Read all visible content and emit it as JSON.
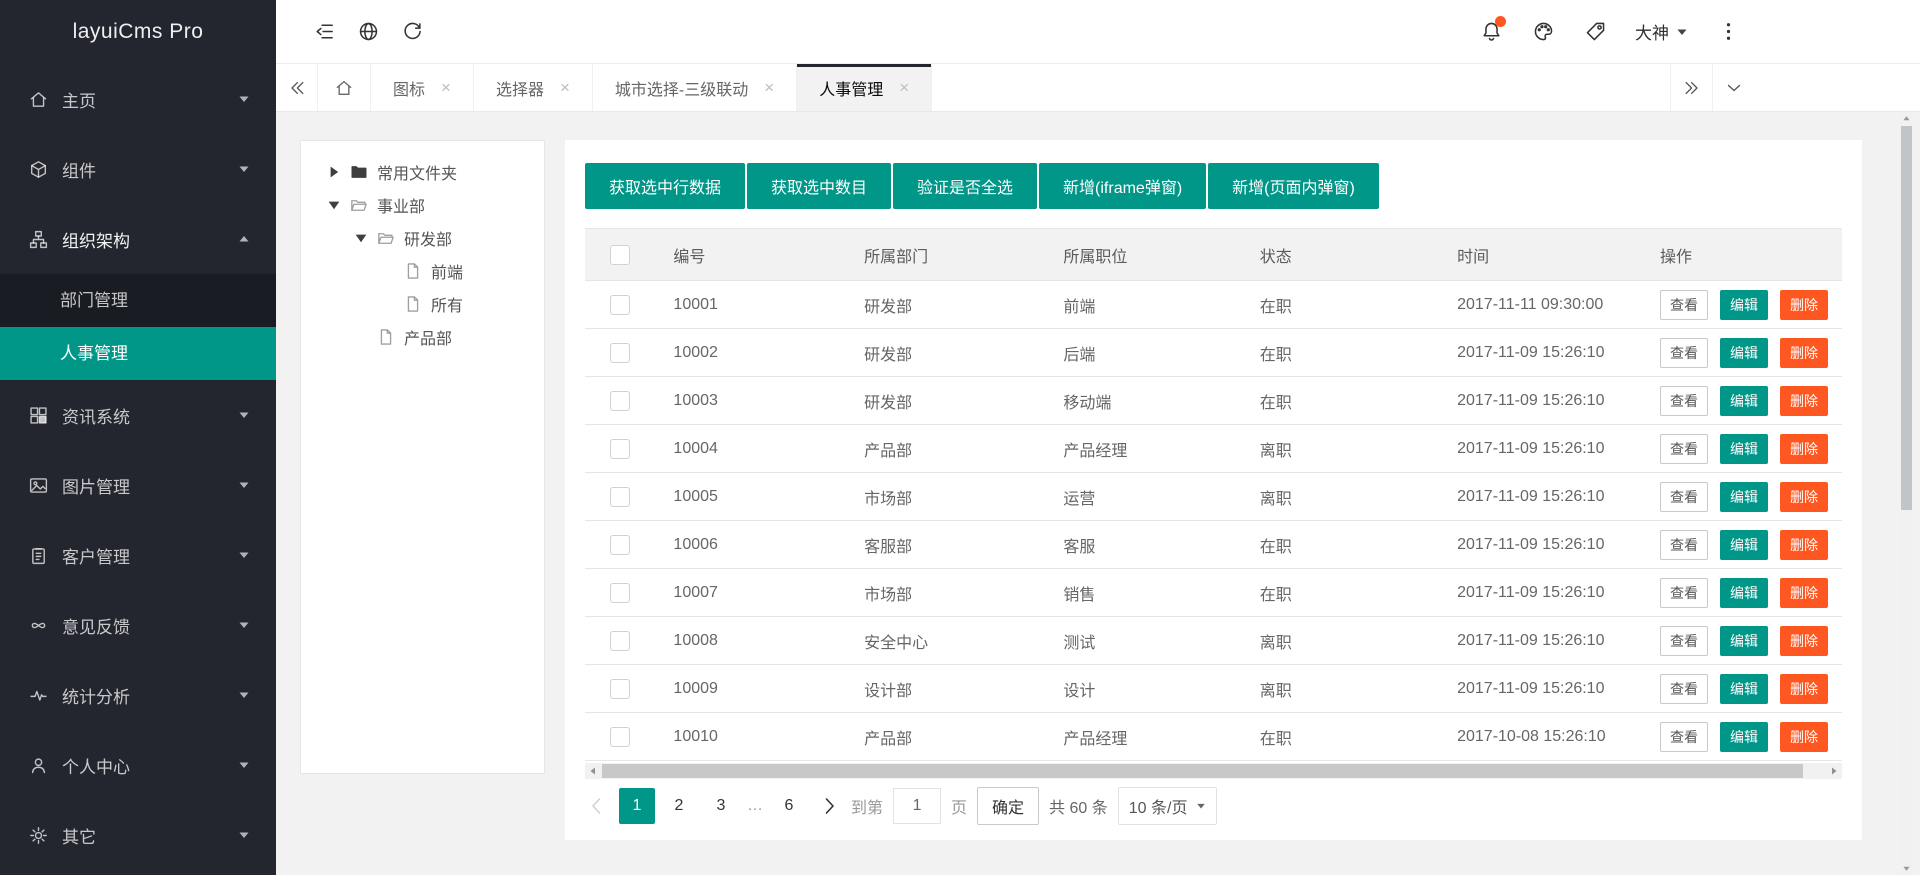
{
  "app": {
    "logo": "layuiCms Pro"
  },
  "header": {
    "left_icons": [
      "collapse",
      "globe",
      "refresh"
    ],
    "right_icons": [
      "bell",
      "palette",
      "tag"
    ],
    "notifications_badge": true,
    "username": "大神",
    "more_icon": "more-vert"
  },
  "tabs": {
    "items": [
      {
        "label": "图标",
        "active": false
      },
      {
        "label": "选择器",
        "active": false
      },
      {
        "label": "城市选择-三级联动",
        "active": false
      },
      {
        "label": "人事管理",
        "active": true
      }
    ]
  },
  "sidebar": {
    "items": [
      {
        "label": "主页",
        "icon": "home",
        "state": "collapsed"
      },
      {
        "label": "组件",
        "icon": "cube",
        "state": "collapsed"
      },
      {
        "label": "组织架构",
        "icon": "org",
        "state": "expanded",
        "children": [
          {
            "label": "部门管理",
            "active": false
          },
          {
            "label": "人事管理",
            "active": true
          }
        ]
      },
      {
        "label": "资讯系统",
        "icon": "grid",
        "state": "collapsed"
      },
      {
        "label": "图片管理",
        "icon": "image",
        "state": "collapsed"
      },
      {
        "label": "客户管理",
        "icon": "clipboard",
        "state": "collapsed"
      },
      {
        "label": "意见反馈",
        "icon": "infinity",
        "state": "collapsed"
      },
      {
        "label": "统计分析",
        "icon": "pulse",
        "state": "collapsed"
      },
      {
        "label": "个人中心",
        "icon": "user",
        "state": "collapsed"
      },
      {
        "label": "其它",
        "icon": "gear",
        "state": "collapsed"
      }
    ]
  },
  "tree": {
    "nodes": [
      {
        "label": "常用文件夹",
        "level": 0,
        "arrow": "right",
        "icon": "folder-filled"
      },
      {
        "label": "事业部",
        "level": 0,
        "arrow": "down",
        "icon": "folder-open"
      },
      {
        "label": "研发部",
        "level": 1,
        "arrow": "down",
        "icon": "folder-open"
      },
      {
        "label": "前端",
        "level": 2,
        "arrow": null,
        "icon": "file"
      },
      {
        "label": "所有",
        "level": 2,
        "arrow": null,
        "icon": "file"
      },
      {
        "label": "产品部",
        "level": 1,
        "arrow": null,
        "icon": "file"
      }
    ]
  },
  "toolbar": {
    "buttons": [
      "获取选中行数据",
      "获取选中数目",
      "验证是否全选",
      "新增(iframe弹窗)",
      "新增(页面内弹窗)"
    ]
  },
  "table": {
    "columns": [
      "编号",
      "所属部门",
      "所属职位",
      "状态",
      "时间",
      "操作"
    ],
    "action_labels": [
      "查看",
      "编辑",
      "删除"
    ],
    "rows": [
      {
        "id": "10001",
        "dept": "研发部",
        "position": "前端",
        "status": "在职",
        "time": "2017-11-11 09:30:00"
      },
      {
        "id": "10002",
        "dept": "研发部",
        "position": "后端",
        "status": "在职",
        "time": "2017-11-09 15:26:10"
      },
      {
        "id": "10003",
        "dept": "研发部",
        "position": "移动端",
        "status": "在职",
        "time": "2017-11-09 15:26:10"
      },
      {
        "id": "10004",
        "dept": "产品部",
        "position": "产品经理",
        "status": "离职",
        "time": "2017-11-09 15:26:10"
      },
      {
        "id": "10005",
        "dept": "市场部",
        "position": "运营",
        "status": "离职",
        "time": "2017-11-09 15:26:10"
      },
      {
        "id": "10006",
        "dept": "客服部",
        "position": "客服",
        "status": "在职",
        "time": "2017-11-09 15:26:10"
      },
      {
        "id": "10007",
        "dept": "市场部",
        "position": "销售",
        "status": "在职",
        "time": "2017-11-09 15:26:10"
      },
      {
        "id": "10008",
        "dept": "安全中心",
        "position": "测试",
        "status": "离职",
        "time": "2017-11-09 15:26:10"
      },
      {
        "id": "10009",
        "dept": "设计部",
        "position": "设计",
        "status": "离职",
        "time": "2017-11-09 15:26:10"
      },
      {
        "id": "10010",
        "dept": "产品部",
        "position": "产品经理",
        "status": "在职",
        "time": "2017-10-08 15:26:10"
      }
    ]
  },
  "pagination": {
    "pages": [
      "1",
      "2",
      "3",
      "…",
      "6"
    ],
    "current": "1",
    "jump_prefix": "到第",
    "jump_value": "1",
    "jump_suffix": "页",
    "confirm_label": "确定",
    "total_label": "共 60 条",
    "page_size": "10 条/页"
  },
  "colors": {
    "accent": "#009688",
    "danger": "#FF5722",
    "sidebar_bg": "#23262E",
    "badge": "#FF5722"
  }
}
